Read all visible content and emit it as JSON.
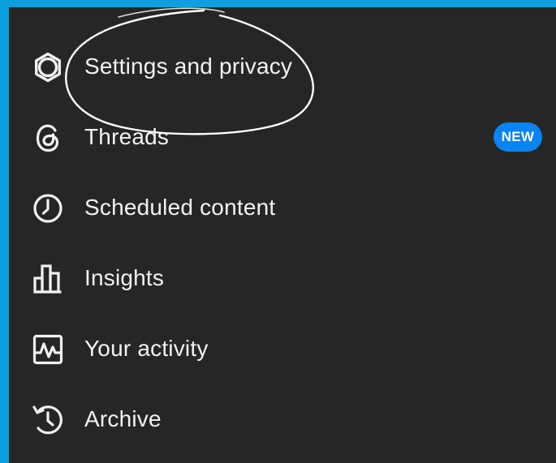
{
  "menu": {
    "items": [
      {
        "label": "Settings and privacy",
        "icon": "gear-icon"
      },
      {
        "label": "Threads",
        "icon": "threads-icon",
        "badge": "NEW"
      },
      {
        "label": "Scheduled content",
        "icon": "clock-icon"
      },
      {
        "label": "Insights",
        "icon": "bar-chart-icon"
      },
      {
        "label": "Your activity",
        "icon": "activity-icon"
      },
      {
        "label": "Archive",
        "icon": "archive-icon"
      }
    ]
  },
  "colors": {
    "border": "#0aa0df",
    "background": "#262626",
    "text": "#f2f2f2",
    "badge": "#0a84f0",
    "annotation": "#ffffff"
  }
}
